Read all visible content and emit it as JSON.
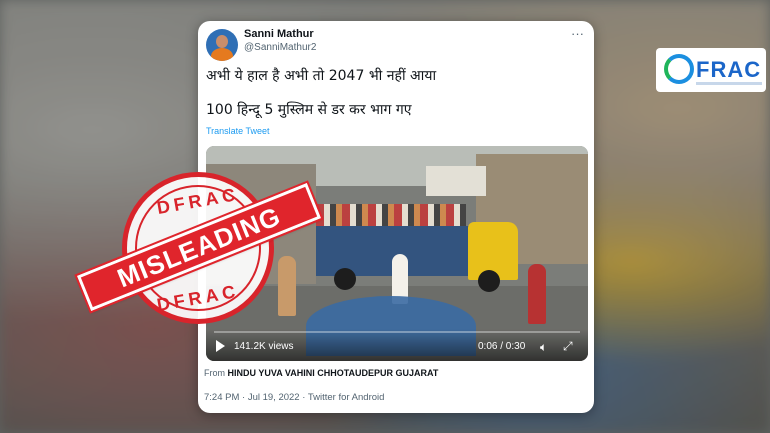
{
  "tweet": {
    "author_name": "Sanni Mathur",
    "author_handle": "@SanniMathur2",
    "more_icon": "more-dots-icon",
    "text_line1": "अभी ये हाल है अभी तो 2047 भी नहीं आया",
    "text_line2": "100 हिन्दू 5 मुस्लिम से डर कर भाग गए",
    "translate_label": "Translate Tweet",
    "video": {
      "views": "141.2K views",
      "time": "0:06 / 0:30",
      "play_icon": "play-icon",
      "volume_icon": "volume-icon",
      "fullscreen_icon": "fullscreen-icon"
    },
    "from_prefix": "From",
    "from_source": "HINDU YUVA VAHINI CHHOTAUDEPUR GUJARAT",
    "meta": "7:24 PM · Jul 19, 2022 · Twitter for Android"
  },
  "stamp": {
    "top_text": "DFRAC",
    "band_text": "MISLEADING",
    "bottom_text": "DFRAC",
    "color": "#d8242b"
  },
  "logo": {
    "text": "FRAC",
    "color": "#1b66c9"
  }
}
